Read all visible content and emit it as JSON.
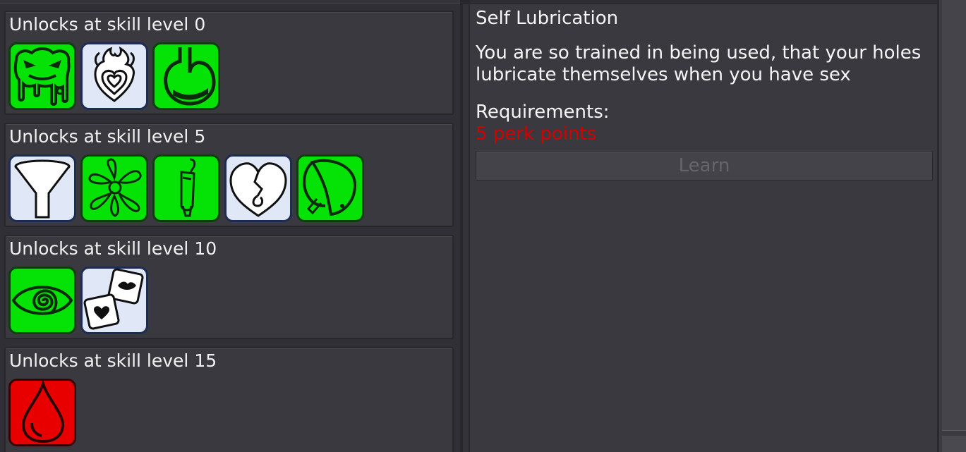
{
  "groups": [
    {
      "title": "Unlocks at skill level 0",
      "perks": [
        {
          "icon": "slime-face-icon",
          "style": "green"
        },
        {
          "icon": "flaming-heart-icon",
          "style": "white"
        },
        {
          "icon": "stomach-icon",
          "style": "green"
        }
      ]
    },
    {
      "title": "Unlocks at skill level 5",
      "perks": [
        {
          "icon": "funnel-icon",
          "style": "white"
        },
        {
          "icon": "splash-icon",
          "style": "green"
        },
        {
          "icon": "tube-icon",
          "style": "green"
        },
        {
          "icon": "heart-hook-icon",
          "style": "white"
        },
        {
          "icon": "fortune-cookie-icon",
          "style": "green"
        }
      ]
    },
    {
      "title": "Unlocks at skill level 10",
      "perks": [
        {
          "icon": "hypno-eye-icon",
          "style": "green"
        },
        {
          "icon": "dice-lips-heart-icon",
          "style": "white"
        }
      ]
    },
    {
      "title": "Unlocks at skill level 15",
      "perks": [
        {
          "icon": "drop-icon",
          "style": "red"
        }
      ]
    }
  ],
  "detail": {
    "title": "Self Lubrication",
    "description": "You are so trained in being used, that your holes lubricate themselves when you have sex",
    "requirements_label": "Requirements:",
    "requirement": "5 perk points",
    "learn_label": "Learn"
  },
  "colors": {
    "perk_green": "#05e205",
    "perk_white": "#e0e8f8",
    "perk_red": "#e80000",
    "requirement_unmet": "#d40000"
  }
}
